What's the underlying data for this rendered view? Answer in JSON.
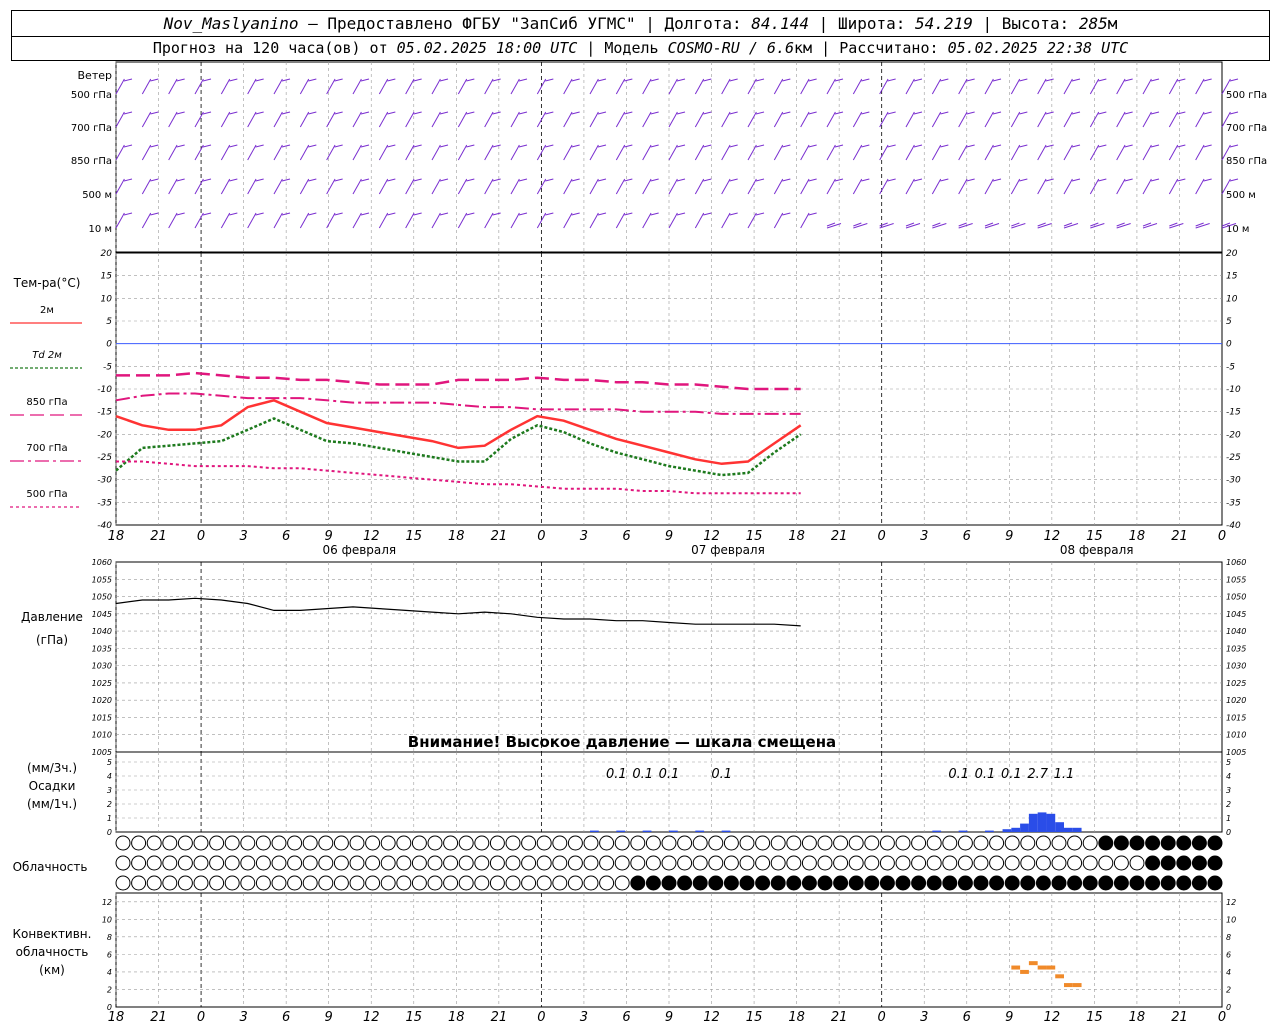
{
  "header": {
    "station": "Nov_Maslyanino",
    "provider": "— Предоставлено ФГБУ \"ЗапСиб УГМС\"",
    "lon_label": "Долгота:",
    "lon": "84.144",
    "lat_label": "Широта:",
    "lat": "54.219",
    "alt_label": "Высота:",
    "alt": "285",
    "alt_unit": "м",
    "forecast_label": "Прогноз на 120 часа(ов) от",
    "forecast_time": "05.02.2025 18:00 UTC",
    "model_label": "Модель",
    "model": "COSMO-RU / 6.6",
    "model_unit": "км",
    "computed_label": "Рассчитано:",
    "computed_time": "05.02.2025 22:38 UTC"
  },
  "chart_data": [
    {
      "type": "line",
      "panel": "wind",
      "label": "Ветер",
      "levels": [
        "500 гПа",
        "700 гПа",
        "850 гПа",
        "500 м",
        "10 м"
      ]
    },
    {
      "type": "line",
      "panel": "temperature",
      "ylabel": "Тем-ра(°C)",
      "ylim": [
        -40,
        20
      ],
      "yticks": [
        20,
        15,
        10,
        5,
        0,
        -5,
        -10,
        -15,
        -20,
        -25,
        -30,
        -35,
        -40
      ],
      "x_hours": [
        0,
        3,
        6,
        9,
        12,
        15,
        18,
        21,
        24,
        27,
        30,
        33,
        36,
        39,
        42,
        45,
        48,
        51,
        54,
        57,
        60,
        63,
        66,
        69,
        72,
        75,
        78
      ],
      "series": [
        {
          "name": "2м",
          "color": "#ff3333",
          "values": [
            -16,
            -18,
            -19,
            -19,
            -18,
            -14,
            -12.5,
            -15,
            -17.5,
            -18.5,
            -19.5,
            -20.5,
            -21.5,
            -23,
            -22.5,
            -19,
            -16,
            -17,
            -19,
            -21,
            -22.5,
            -24,
            -25.5,
            -26.5,
            -26,
            -22,
            -18
          ]
        },
        {
          "name": "Td 2м",
          "color": "#1e7a1e",
          "values": [
            -28,
            -23,
            -22.5,
            -22,
            -21.5,
            -19,
            -16.5,
            -19,
            -21.5,
            -22,
            -23,
            -24,
            -25,
            -26,
            -26,
            -21,
            -18,
            -19.5,
            -22,
            -24,
            -25.5,
            -27,
            -28,
            -29,
            -28.5,
            -24,
            -20
          ]
        },
        {
          "name": "850 гПа",
          "color": "#e0167d",
          "values": [
            -7,
            -7,
            -7,
            -6.5,
            -7,
            -7.5,
            -7.5,
            -8,
            -8,
            -8.5,
            -9,
            -9,
            -9,
            -8,
            -8,
            -8,
            -7.5,
            -8,
            -8,
            -8.5,
            -8.5,
            -9,
            -9,
            -9.5,
            -10,
            -10,
            -10
          ]
        },
        {
          "name": "700 гПа",
          "color": "#e0167d",
          "values": [
            -12.5,
            -11.5,
            -11,
            -11,
            -11.5,
            -12,
            -12,
            -12,
            -12.5,
            -13,
            -13,
            -13,
            -13,
            -13.5,
            -14,
            -14,
            -14.5,
            -14.5,
            -14.5,
            -14.5,
            -15,
            -15,
            -15,
            -15.5,
            -15.5,
            -15.5,
            -15.5
          ]
        },
        {
          "name": "500 гПа",
          "color": "#e0167d",
          "values": [
            -26,
            -26,
            -26.5,
            -27,
            -27,
            -27,
            -27.5,
            -27.5,
            -28,
            -28.5,
            -29,
            -29.5,
            -30,
            -30.5,
            -31,
            -31,
            -31.5,
            -32,
            -32,
            -32,
            -32.5,
            -32.5,
            -33,
            -33,
            -33,
            -33,
            -33
          ]
        }
      ]
    },
    {
      "type": "line",
      "panel": "pressure",
      "ylabel": "Давление",
      "yunit": "(гПа)",
      "ylim": [
        1005,
        1060
      ],
      "yticks": [
        1060,
        1055,
        1050,
        1045,
        1040,
        1035,
        1030,
        1025,
        1020,
        1015,
        1010,
        1005
      ],
      "note": "Внимание! Высокое давление — шкала смещена",
      "x_hours": [
        0,
        3,
        6,
        9,
        12,
        15,
        18,
        21,
        24,
        27,
        30,
        33,
        36,
        39,
        42,
        45,
        48,
        51,
        54,
        57,
        60,
        63,
        66,
        69,
        72,
        75,
        78
      ],
      "series": [
        {
          "name": "Давление",
          "color": "#000000",
          "values": [
            1048,
            1049,
            1049,
            1049.5,
            1049,
            1048,
            1046,
            1046,
            1046.5,
            1047,
            1046.5,
            1046,
            1045.5,
            1045,
            1045.5,
            1045,
            1044,
            1043.5,
            1043.5,
            1043,
            1043,
            1042.5,
            1042,
            1042,
            1042,
            1042,
            1041.5
          ]
        }
      ]
    },
    {
      "type": "bar",
      "panel": "precip",
      "ylabel_top": "(мм/3ч.)",
      "ylabel_mid": "Осадки",
      "ylabel_bot": "(мм/1ч.)",
      "ylim": [
        0,
        5
      ],
      "yticks": [
        5,
        4,
        3,
        2,
        1,
        0
      ],
      "totals": [
        {
          "hour": 57,
          "text": "0.1"
        },
        {
          "hour": 60,
          "text": "0.1"
        },
        {
          "hour": 63,
          "text": "0.1"
        },
        {
          "hour": 69,
          "text": "0.1"
        },
        {
          "hour": 96,
          "text": "0.1"
        },
        {
          "hour": 99,
          "text": "0.1"
        },
        {
          "hour": 102,
          "text": "0.1"
        },
        {
          "hour": 105,
          "text": "2.7"
        },
        {
          "hour": 108,
          "text": "1.1"
        }
      ],
      "x_hours": [
        54,
        57,
        60,
        63,
        66,
        69,
        93,
        96,
        99,
        101,
        102,
        103,
        104,
        105,
        106,
        107,
        108,
        109
      ],
      "values": [
        0.1,
        0.1,
        0.1,
        0.1,
        0.1,
        0.1,
        0.1,
        0.1,
        0.1,
        0.2,
        0.3,
        0.6,
        1.3,
        1.4,
        1.3,
        0.7,
        0.3,
        0.3
      ]
    },
    {
      "type": "table",
      "panel": "clouds",
      "label": "Облачность",
      "rows": 3,
      "cells_per_row": 71
    },
    {
      "type": "bar",
      "panel": "convective",
      "ylabel": [
        "Конвективн.",
        "облачность",
        "(км)"
      ],
      "ylim": [
        0,
        13
      ],
      "yticks": [
        12,
        10,
        8,
        6,
        4,
        2,
        0
      ],
      "color": "#f08a2a",
      "x_hours": [
        102,
        103,
        104,
        105,
        106,
        107,
        108,
        109
      ],
      "values": [
        4.5,
        4,
        5,
        4.5,
        4.5,
        3.5,
        2.5,
        2.5
      ]
    }
  ],
  "x_axis": {
    "tick_labels": [
      "18",
      "21",
      "0",
      "3",
      "6",
      "9",
      "12",
      "15",
      "18",
      "21",
      "0",
      "3",
      "6",
      "9",
      "12",
      "15",
      "18",
      "21",
      "0",
      "3",
      "6",
      "9",
      "12",
      "15",
      "18",
      "21",
      "0"
    ],
    "dates": [
      "06 февраля",
      "07 февраля",
      "08 февраля"
    ]
  }
}
